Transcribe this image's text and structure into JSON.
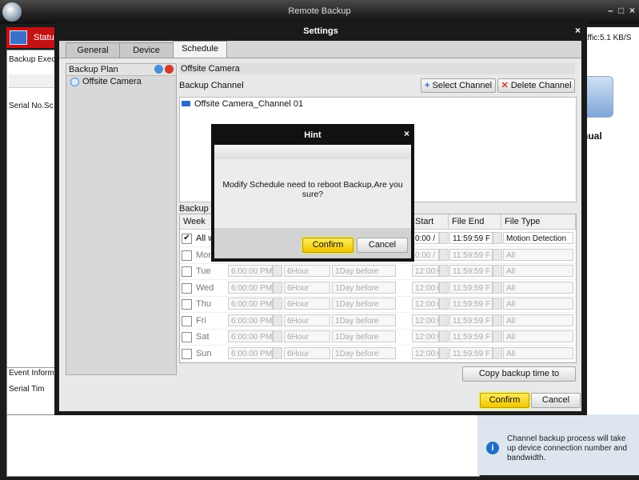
{
  "app": {
    "title": "Remote Backup",
    "minimize": "–",
    "maximize": "□",
    "close": "×",
    "status_tab": "Status",
    "traffic": "affic:5.1 KB/S",
    "backup_exec": "Backup Exec",
    "serial_no": "Serial No.Sc",
    "event_inform": "Event Inform",
    "event_cols": "Serial  Tim",
    "manual": "nual",
    "info_text": "Channel backup process will take up device connection number and bandwidth."
  },
  "settings": {
    "title": "Settings",
    "close": "×",
    "tabs": [
      {
        "label": "General"
      },
      {
        "label": "Device"
      },
      {
        "label": "Schedule"
      }
    ],
    "backup_plan_label": "Backup Plan",
    "plan_items": [
      "Offsite Camera"
    ],
    "camera_name": "Offsite Camera",
    "backup_channel_label": "Backup Channel",
    "select_channel": "Select Channel",
    "delete_channel": "Delete Channel",
    "channels": [
      "Offsite Camera_Channel 01"
    ],
    "backup_time_label": "Backup T",
    "columns": {
      "week": "Week",
      "start": "Start",
      "file_end": "File End",
      "file_type": "File Type"
    },
    "rows": [
      {
        "day": "All w",
        "checked": true,
        "start": "0:00 /",
        "file_end": "11:59:59 F",
        "file_type": "Motion Detection",
        "enabled": true
      },
      {
        "day": "Mon",
        "checked": false,
        "start": "0:00 /",
        "file_end": "11:59:59 F",
        "file_type": "All",
        "enabled": false
      },
      {
        "day": "Tue",
        "checked": false,
        "time": "6:00:00 PM",
        "period": "6Hour",
        "before": "1Day before",
        "start": "12:00:00 /",
        "file_end": "11:59:59 F",
        "file_type": "All",
        "enabled": false
      },
      {
        "day": "Wed",
        "checked": false,
        "time": "6:00:00 PM",
        "period": "6Hour",
        "before": "1Day before",
        "start": "12:00:00 /",
        "file_end": "11:59:59 F",
        "file_type": "All",
        "enabled": false
      },
      {
        "day": "Thu",
        "checked": false,
        "time": "6:00:00 PM",
        "period": "6Hour",
        "before": "1Day before",
        "start": "12:00:00 /",
        "file_end": "11:59:59 F",
        "file_type": "All",
        "enabled": false
      },
      {
        "day": "Fri",
        "checked": false,
        "time": "6:00:00 PM",
        "period": "6Hour",
        "before": "1Day before",
        "start": "12:00:00 /",
        "file_end": "11:59:59 F",
        "file_type": "All",
        "enabled": false
      },
      {
        "day": "Sat",
        "checked": false,
        "time": "6:00:00 PM",
        "period": "6Hour",
        "before": "1Day before",
        "start": "12:00:00 /",
        "file_end": "11:59:59 F",
        "file_type": "All",
        "enabled": false
      },
      {
        "day": "Sun",
        "checked": false,
        "time": "6:00:00 PM",
        "period": "6Hour",
        "before": "1Day before",
        "start": "12:00:00 /",
        "file_end": "11:59:59 F",
        "file_type": "All",
        "enabled": false
      }
    ],
    "copy_button": "Copy backup time to",
    "confirm": "Confirm",
    "cancel": "Cancel"
  },
  "hint": {
    "title": "Hint",
    "close": "×",
    "message": "Modify Schedule need to reboot Backup,Are you sure?",
    "confirm": "Confirm",
    "cancel": "Cancel"
  },
  "colors": {
    "accent_yellow": "#f3c600",
    "status_red": "#c41212",
    "titlebar": "#1a1a1a"
  }
}
